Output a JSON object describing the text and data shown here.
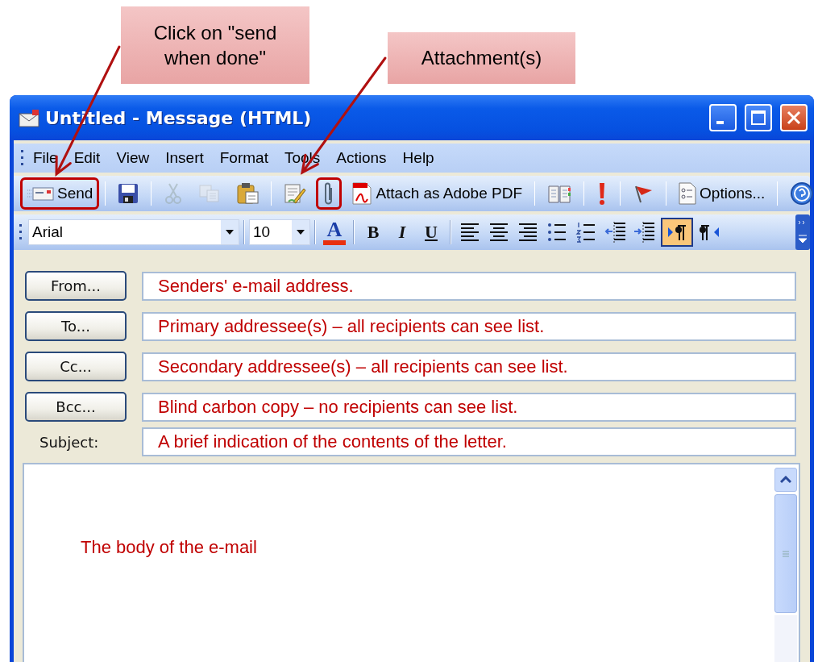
{
  "callouts": [
    {
      "text": "Click on \"send when done\""
    },
    {
      "text": "Attachment(s)"
    }
  ],
  "window": {
    "title": "Untitled - Message (HTML)"
  },
  "menu": [
    "File",
    "Edit",
    "View",
    "Insert",
    "Format",
    "Tools",
    "Actions",
    "Help"
  ],
  "toolbar": [
    {
      "kind": "button",
      "label": "Send",
      "disabled": false,
      "highlighted": true
    },
    {
      "kind": "separator"
    },
    {
      "kind": "button",
      "disabled": false,
      "highlighted": false
    },
    {
      "kind": "separator"
    },
    {
      "kind": "button",
      "disabled": true,
      "highlighted": false
    },
    {
      "kind": "button",
      "disabled": true,
      "highlighted": false
    },
    {
      "kind": "button",
      "disabled": false,
      "highlighted": false
    },
    {
      "kind": "separator"
    },
    {
      "kind": "button",
      "disabled": false,
      "highlighted": false
    },
    {
      "kind": "button",
      "disabled": false,
      "highlighted": true
    },
    {
      "kind": "button",
      "label": "Attach as Adobe PDF",
      "disabled": false,
      "highlighted": false
    },
    {
      "kind": "separator"
    },
    {
      "kind": "button",
      "disabled": false,
      "highlighted": false
    },
    {
      "kind": "separator"
    },
    {
      "kind": "button",
      "disabled": false,
      "highlighted": false
    },
    {
      "kind": "separator"
    },
    {
      "kind": "button",
      "disabled": false,
      "highlighted": false
    },
    {
      "kind": "separator"
    },
    {
      "kind": "button",
      "label": "Options...",
      "disabled": false,
      "highlighted": false
    },
    {
      "kind": "separator"
    },
    {
      "kind": "button",
      "disabled": false,
      "highlighted": false
    }
  ],
  "format_bar": {
    "font": "Arial",
    "size": "10",
    "items": [
      {
        "kind": "color",
        "label": "A",
        "on": false
      },
      {
        "kind": "separator"
      },
      {
        "kind": "text",
        "label": "B",
        "on": false
      },
      {
        "kind": "text",
        "label": "I",
        "on": false
      },
      {
        "kind": "text",
        "label": "U",
        "on": false
      },
      {
        "kind": "separator"
      },
      {
        "kind": "icon",
        "on": false
      },
      {
        "kind": "icon",
        "on": false
      },
      {
        "kind": "icon",
        "on": false
      },
      {
        "kind": "icon",
        "on": false
      },
      {
        "kind": "icon",
        "on": false
      },
      {
        "kind": "icon",
        "on": false
      },
      {
        "kind": "icon",
        "on": false
      },
      {
        "kind": "icon",
        "on": true
      },
      {
        "kind": "icon",
        "on": false
      }
    ]
  },
  "address_rows": [
    {
      "button": "From...",
      "value": "Senders' e-mail address."
    },
    {
      "button": "To...",
      "value": "Primary addressee(s) – all recipients can see list."
    },
    {
      "button": "Cc...",
      "value": "Secondary addressee(s) – all recipients can see list."
    },
    {
      "button": "Bcc...",
      "value": "Blind carbon copy – no recipients can see list."
    }
  ],
  "subject": {
    "label": "Subject:",
    "value": "A brief indication of the contents of the letter."
  },
  "body": {
    "value": "The body of the e-mail"
  }
}
